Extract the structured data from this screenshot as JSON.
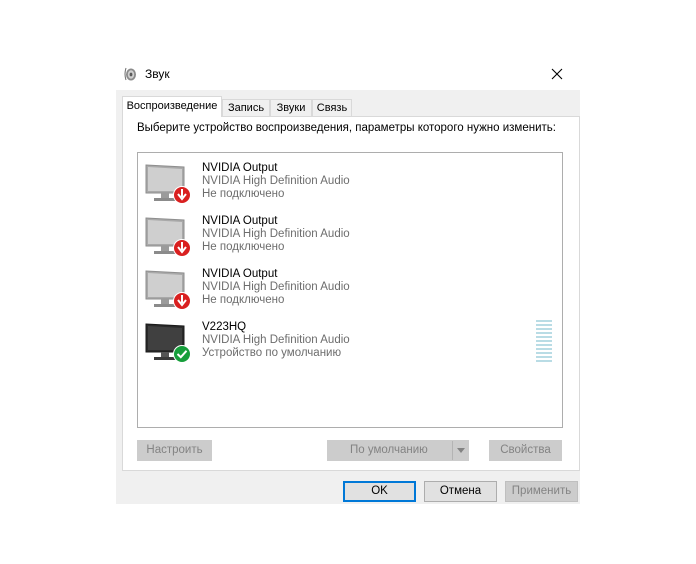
{
  "window": {
    "title": "Звук",
    "icon": "speaker-icon",
    "close_icon": "close-icon"
  },
  "tabs": [
    {
      "label": "Воспроизведение",
      "active": true
    },
    {
      "label": "Запись",
      "active": false
    },
    {
      "label": "Звуки",
      "active": false
    },
    {
      "label": "Связь",
      "active": false
    }
  ],
  "instruction": "Выберите устройство воспроизведения, параметры которого нужно изменить:",
  "devices": [
    {
      "name": "NVIDIA Output",
      "description": "NVIDIA High Definition Audio",
      "status": "Не подключено",
      "state_icon": "disconnected-arrow-icon",
      "state_color": "#d92020"
    },
    {
      "name": "NVIDIA Output",
      "description": "NVIDIA High Definition Audio",
      "status": "Не подключено",
      "state_icon": "disconnected-arrow-icon",
      "state_color": "#d92020"
    },
    {
      "name": "NVIDIA Output",
      "description": "NVIDIA High Definition Audio",
      "status": "Не подключено",
      "state_icon": "disconnected-arrow-icon",
      "state_color": "#d92020"
    },
    {
      "name": "V223HQ",
      "description": "NVIDIA High Definition Audio",
      "status": "Устройство по умолчанию",
      "state_icon": "default-check-icon",
      "state_color": "#169e3b"
    }
  ],
  "buttons": {
    "configure": "Настроить",
    "set_default": "По умолчанию",
    "properties": "Свойства",
    "ok": "OK",
    "cancel": "Отмена",
    "apply": "Применить"
  },
  "colors": {
    "accent": "#0078d7",
    "meter": "#b9dce5"
  }
}
